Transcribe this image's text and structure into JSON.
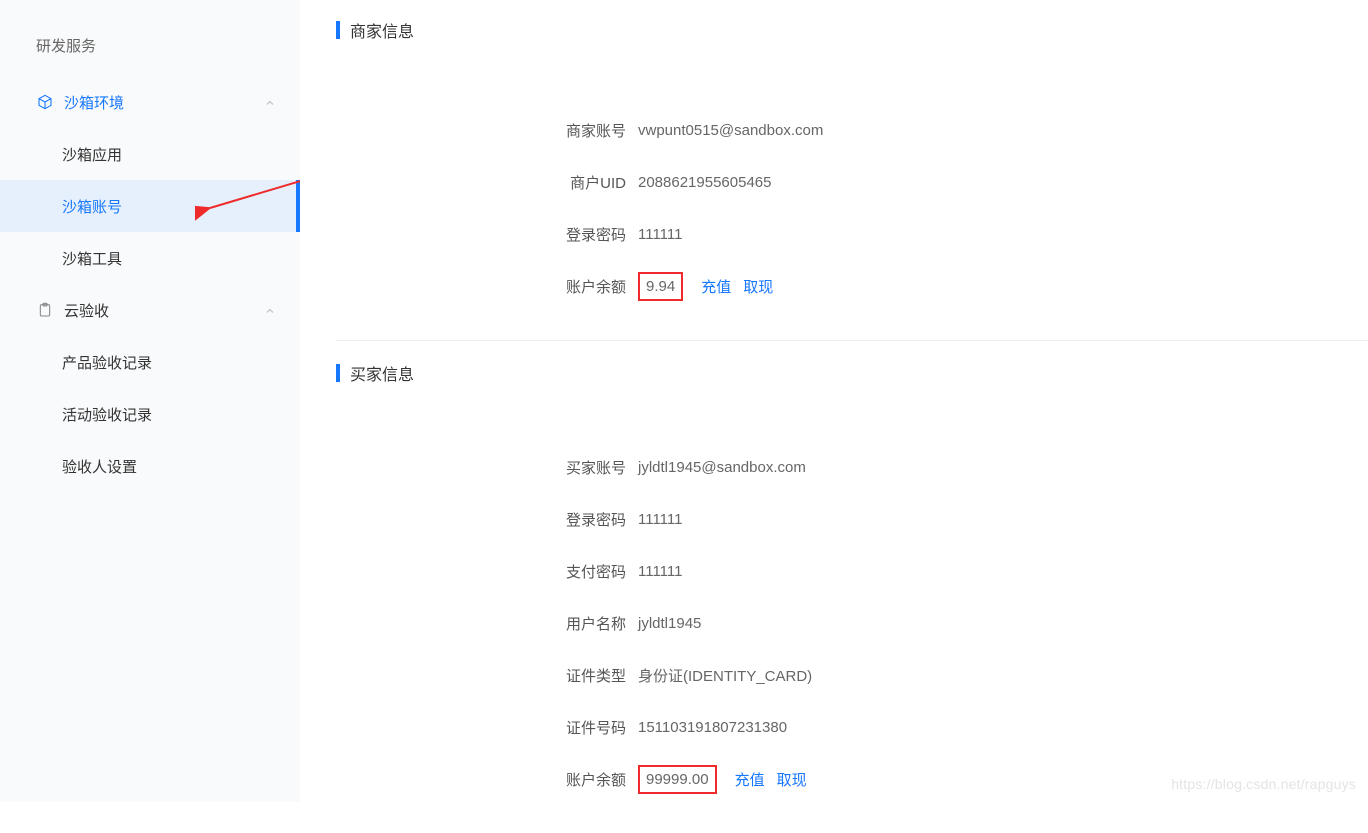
{
  "sidebar": {
    "group_title": "研发服务",
    "sandbox": {
      "label": "沙箱环境",
      "items": [
        {
          "label": "沙箱应用"
        },
        {
          "label": "沙箱账号"
        },
        {
          "label": "沙箱工具"
        }
      ]
    },
    "cloud": {
      "label": "云验收",
      "items": [
        {
          "label": "产品验收记录"
        },
        {
          "label": "活动验收记录"
        },
        {
          "label": "验收人设置"
        }
      ]
    }
  },
  "merchant": {
    "title": "商家信息",
    "account_label": "商家账号",
    "account_value": "vwpunt0515@sandbox.com",
    "uid_label": "商户UID",
    "uid_value": "2088621955605465",
    "login_pwd_label": "登录密码",
    "login_pwd_value": "111111",
    "balance_label": "账户余额",
    "balance_value": "9.94",
    "recharge": "充值",
    "withdraw": "取现"
  },
  "buyer": {
    "title": "买家信息",
    "account_label": "买家账号",
    "account_value": "jyldtl1945@sandbox.com",
    "login_pwd_label": "登录密码",
    "login_pwd_value": "111111",
    "pay_pwd_label": "支付密码",
    "pay_pwd_value": "111111",
    "name_label": "用户名称",
    "name_value": "jyldtl1945",
    "cert_type_label": "证件类型",
    "cert_type_value": "身份证(IDENTITY_CARD)",
    "cert_no_label": "证件号码",
    "cert_no_value": "151103191807231380",
    "balance_label": "账户余额",
    "balance_value": "99999.00",
    "recharge": "充值",
    "withdraw": "取现"
  },
  "watermark": "https://blog.csdn.net/rapguys"
}
